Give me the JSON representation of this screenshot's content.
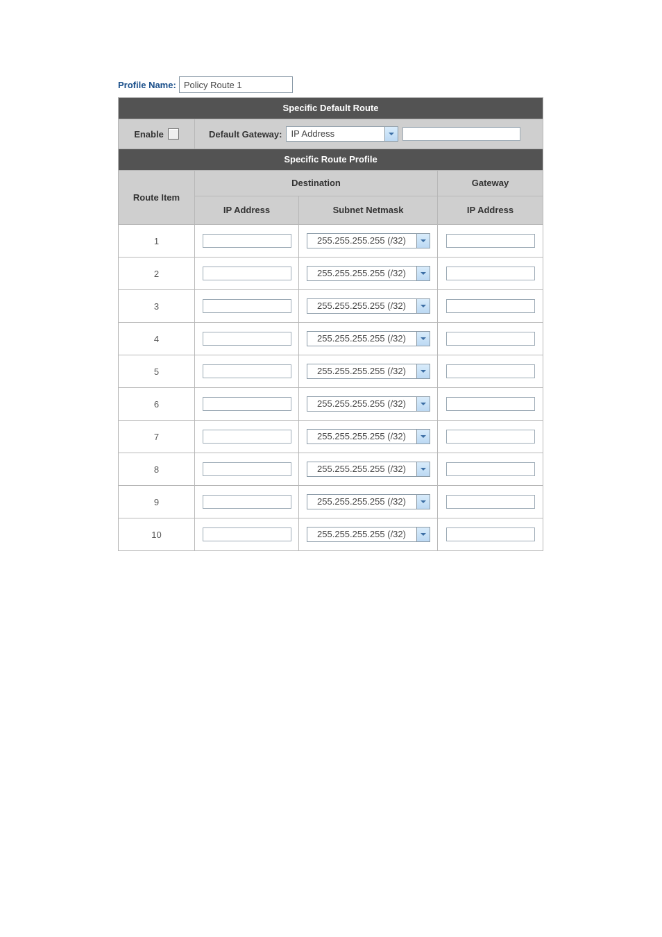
{
  "profile_name_label": "Profile Name:",
  "profile_name_value": "Policy Route 1",
  "section_default_route_title": "Specific Default Route",
  "default_route": {
    "enable_label": "Enable",
    "enable_checked": false,
    "gateway_label": "Default Gateway:",
    "gateway_type_selected": "IP Address",
    "gateway_ip_value": ""
  },
  "section_route_profile_title": "Specific Route Profile",
  "headers": {
    "route_item": "Route Item",
    "destination": "Destination",
    "gateway": "Gateway",
    "dest_ip": "IP Address",
    "dest_netmask": "Subnet Netmask",
    "gateway_ip": "IP Address"
  },
  "netmask_default": "255.255.255.255 (/32)",
  "rows": [
    {
      "idx": "1",
      "dest_ip": "",
      "netmask": "255.255.255.255 (/32)",
      "gateway_ip": ""
    },
    {
      "idx": "2",
      "dest_ip": "",
      "netmask": "255.255.255.255 (/32)",
      "gateway_ip": ""
    },
    {
      "idx": "3",
      "dest_ip": "",
      "netmask": "255.255.255.255 (/32)",
      "gateway_ip": ""
    },
    {
      "idx": "4",
      "dest_ip": "",
      "netmask": "255.255.255.255 (/32)",
      "gateway_ip": ""
    },
    {
      "idx": "5",
      "dest_ip": "",
      "netmask": "255.255.255.255 (/32)",
      "gateway_ip": ""
    },
    {
      "idx": "6",
      "dest_ip": "",
      "netmask": "255.255.255.255 (/32)",
      "gateway_ip": ""
    },
    {
      "idx": "7",
      "dest_ip": "",
      "netmask": "255.255.255.255 (/32)",
      "gateway_ip": ""
    },
    {
      "idx": "8",
      "dest_ip": "",
      "netmask": "255.255.255.255 (/32)",
      "gateway_ip": ""
    },
    {
      "idx": "9",
      "dest_ip": "",
      "netmask": "255.255.255.255 (/32)",
      "gateway_ip": ""
    },
    {
      "idx": "10",
      "dest_ip": "",
      "netmask": "255.255.255.255 (/32)",
      "gateway_ip": ""
    }
  ]
}
